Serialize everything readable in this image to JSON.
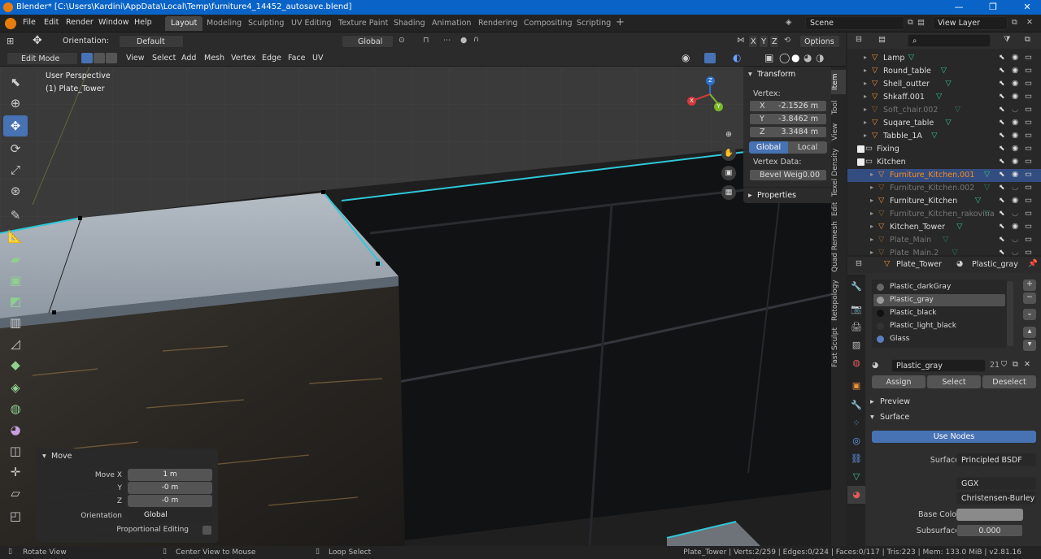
{
  "window": {
    "title": "Blender* [C:\\Users\\Kardini\\AppData\\Local\\Temp\\furniture4_14452_autosave.blend]"
  },
  "menu": [
    "File",
    "Edit",
    "Render",
    "Window",
    "Help"
  ],
  "workspaces": [
    "Layout",
    "Modeling",
    "Sculpting",
    "UV Editing",
    "Texture Paint",
    "Shading",
    "Animation",
    "Rendering",
    "Compositing",
    "Scripting"
  ],
  "scene": {
    "name": "Scene",
    "view_layer": "View Layer"
  },
  "header": {
    "orientation_label": "Orientation:",
    "orientation_value": "Default",
    "transform_orientation": "Global",
    "options": "Options",
    "mode": "Edit Mode",
    "menus": [
      "View",
      "Select",
      "Add",
      "Mesh",
      "Vertex",
      "Edge",
      "Face",
      "UV"
    ],
    "axis_x": "X",
    "axis_y": "Y",
    "axis_z": "Z"
  },
  "viewport": {
    "perspective": "User Perspective",
    "object": "(1) Plate_Tower"
  },
  "npanel": {
    "transform_title": "Transform",
    "vertex_label": "Vertex:",
    "x_label": "X",
    "x": "-2.1526 m",
    "y_label": "Y",
    "y": "-3.8462 m",
    "z_label": "Z",
    "z": "3.3484 m",
    "global": "Global",
    "local": "Local",
    "vertex_data_label": "Vertex Data:",
    "bevel_label": "Bevel Weig",
    "bevel_value": "0.00",
    "properties_title": "Properties",
    "tabs": [
      "Item",
      "Tool",
      "View",
      "Texel Density",
      "Edit",
      "Quad Remesh",
      "Retopology",
      "Fast Sculpt"
    ]
  },
  "gizmo": {
    "x": "X",
    "y": "Y",
    "z": "Z"
  },
  "outliner": {
    "rows": [
      {
        "name": "Lamp",
        "indent": 2,
        "dim": false,
        "type": "mesh"
      },
      {
        "name": "Round_table",
        "indent": 2,
        "dim": false,
        "type": "mesh"
      },
      {
        "name": "Shell_outter",
        "indent": 2,
        "dim": false,
        "type": "mesh"
      },
      {
        "name": "Shkaff.001",
        "indent": 2,
        "dim": false,
        "type": "mesh"
      },
      {
        "name": "Soft_chair.002",
        "indent": 2,
        "dim": true,
        "type": "mesh"
      },
      {
        "name": "Suqare_table",
        "indent": 2,
        "dim": false,
        "type": "mesh"
      },
      {
        "name": "Tabble_1A",
        "indent": 2,
        "dim": false,
        "type": "mesh"
      },
      {
        "name": "Fixing",
        "indent": 1,
        "dim": false,
        "type": "collection"
      },
      {
        "name": "Kitchen",
        "indent": 1,
        "dim": false,
        "type": "collection"
      },
      {
        "name": "Furniture_Kitchen.001",
        "indent": 3,
        "dim": false,
        "type": "mesh",
        "selected": true
      },
      {
        "name": "Furniture_Kitchen.002",
        "indent": 3,
        "dim": true,
        "type": "mesh"
      },
      {
        "name": "Furniture_Kitchen",
        "indent": 3,
        "dim": false,
        "type": "mesh"
      },
      {
        "name": "Furniture_Kitchen_rakovina",
        "indent": 3,
        "dim": true,
        "type": "mesh"
      },
      {
        "name": "Kitchen_Tower",
        "indent": 3,
        "dim": false,
        "type": "mesh"
      },
      {
        "name": "Plate_Main",
        "indent": 3,
        "dim": true,
        "type": "mesh"
      },
      {
        "name": "Plate_Main.2",
        "indent": 3,
        "dim": true,
        "type": "mesh"
      }
    ]
  },
  "properties": {
    "object": "Plate_Tower",
    "material": "Plastic_gray",
    "slots": [
      "Plastic_darkGray",
      "Plastic_gray",
      "Plastic_black",
      "Plastic_light_black",
      "Glass"
    ],
    "slot_colors": [
      "#666666",
      "#9a9a9a",
      "#111111",
      "#333333",
      "#5a7fbf"
    ],
    "selected_slot": 1,
    "material_field": "Plastic_gray",
    "users": "21",
    "assign": "Assign",
    "select": "Select",
    "deselect": "Deselect",
    "preview": "Preview",
    "surface_section": "Surface",
    "use_nodes": "Use Nodes",
    "surface_label": "Surface",
    "surface_value": "Principled BSDF",
    "ggx": "GGX",
    "subsurface_method": "Christensen-Burley",
    "base_color_label": "Base Color",
    "subsurface_label": "Subsurface",
    "subsurface_value": "0.000"
  },
  "move_panel": {
    "title": "Move",
    "move_x_label": "Move X",
    "move_x": "1 m",
    "y_label": "Y",
    "y": "-0 m",
    "z_label": "Z",
    "z": "-0 m",
    "orientation_label": "Orientation",
    "orientation": "Global",
    "proportional_label": "Proportional Editing"
  },
  "status": {
    "rotate": "Rotate View",
    "center": "Center View to Mouse",
    "loop": "Loop Select",
    "stats": "Plate_Tower | Verts:2/259 | Edges:0/224 | Faces:0/117 | Tris:223 | Mem: 133.0 MiB | v2.81.16"
  },
  "colors": {
    "accent": "#4772b3",
    "selection": "#ff8c1a",
    "titlebar": "#0a64c8",
    "mesh_icon": "#e8913a",
    "data_icon": "#36c08a"
  }
}
